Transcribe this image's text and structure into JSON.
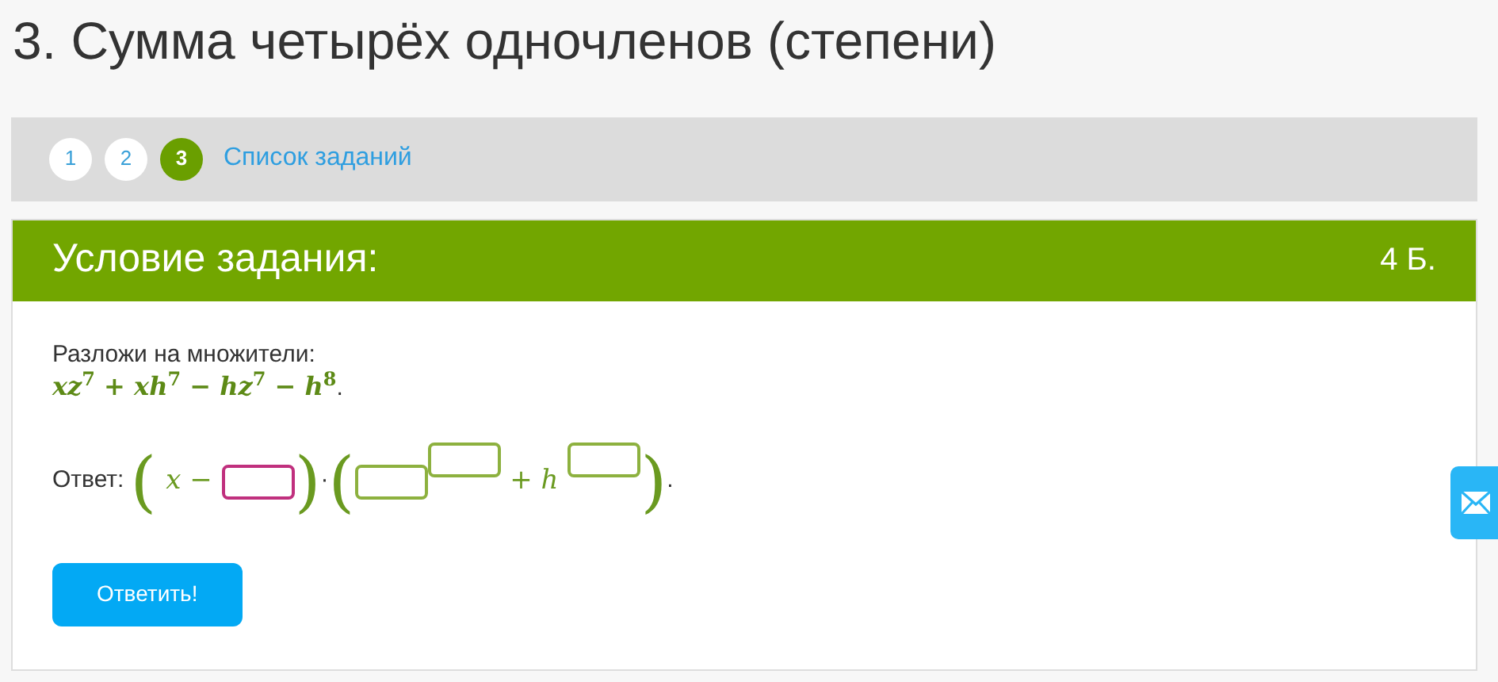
{
  "page_title": "3. Сумма четырёх одночленов (степени)",
  "pager": {
    "pages": [
      {
        "label": "1",
        "selected": false
      },
      {
        "label": "2",
        "selected": false
      },
      {
        "label": "3",
        "selected": true
      }
    ],
    "list_link": "Список заданий"
  },
  "task": {
    "header": "Условие задания:",
    "points": "4 Б.",
    "instruction": "Разложи на множители:",
    "expression": "xz$^{7}$ + xh$^{7}$ − hz$^{7}$ − h$^{8}$",
    "expression_end": ".",
    "answer_label": "Ответ:",
    "answer_parts": [
      {
        "kind": "paren",
        "text": "("
      },
      {
        "kind": "math",
        "text": "x −"
      },
      {
        "kind": "field",
        "focused": true
      },
      {
        "kind": "paren",
        "text": ")"
      },
      {
        "kind": "plain",
        "text": "·"
      },
      {
        "kind": "paren",
        "text": "("
      },
      {
        "kind": "field",
        "focused": false
      },
      {
        "kind": "field_sup",
        "focused": false
      },
      {
        "kind": "math",
        "text": "+ h"
      },
      {
        "kind": "field_sup",
        "focused": false
      },
      {
        "kind": "paren",
        "text": ")"
      },
      {
        "kind": "plain",
        "text": "."
      }
    ],
    "submit": "Ответить!"
  }
}
